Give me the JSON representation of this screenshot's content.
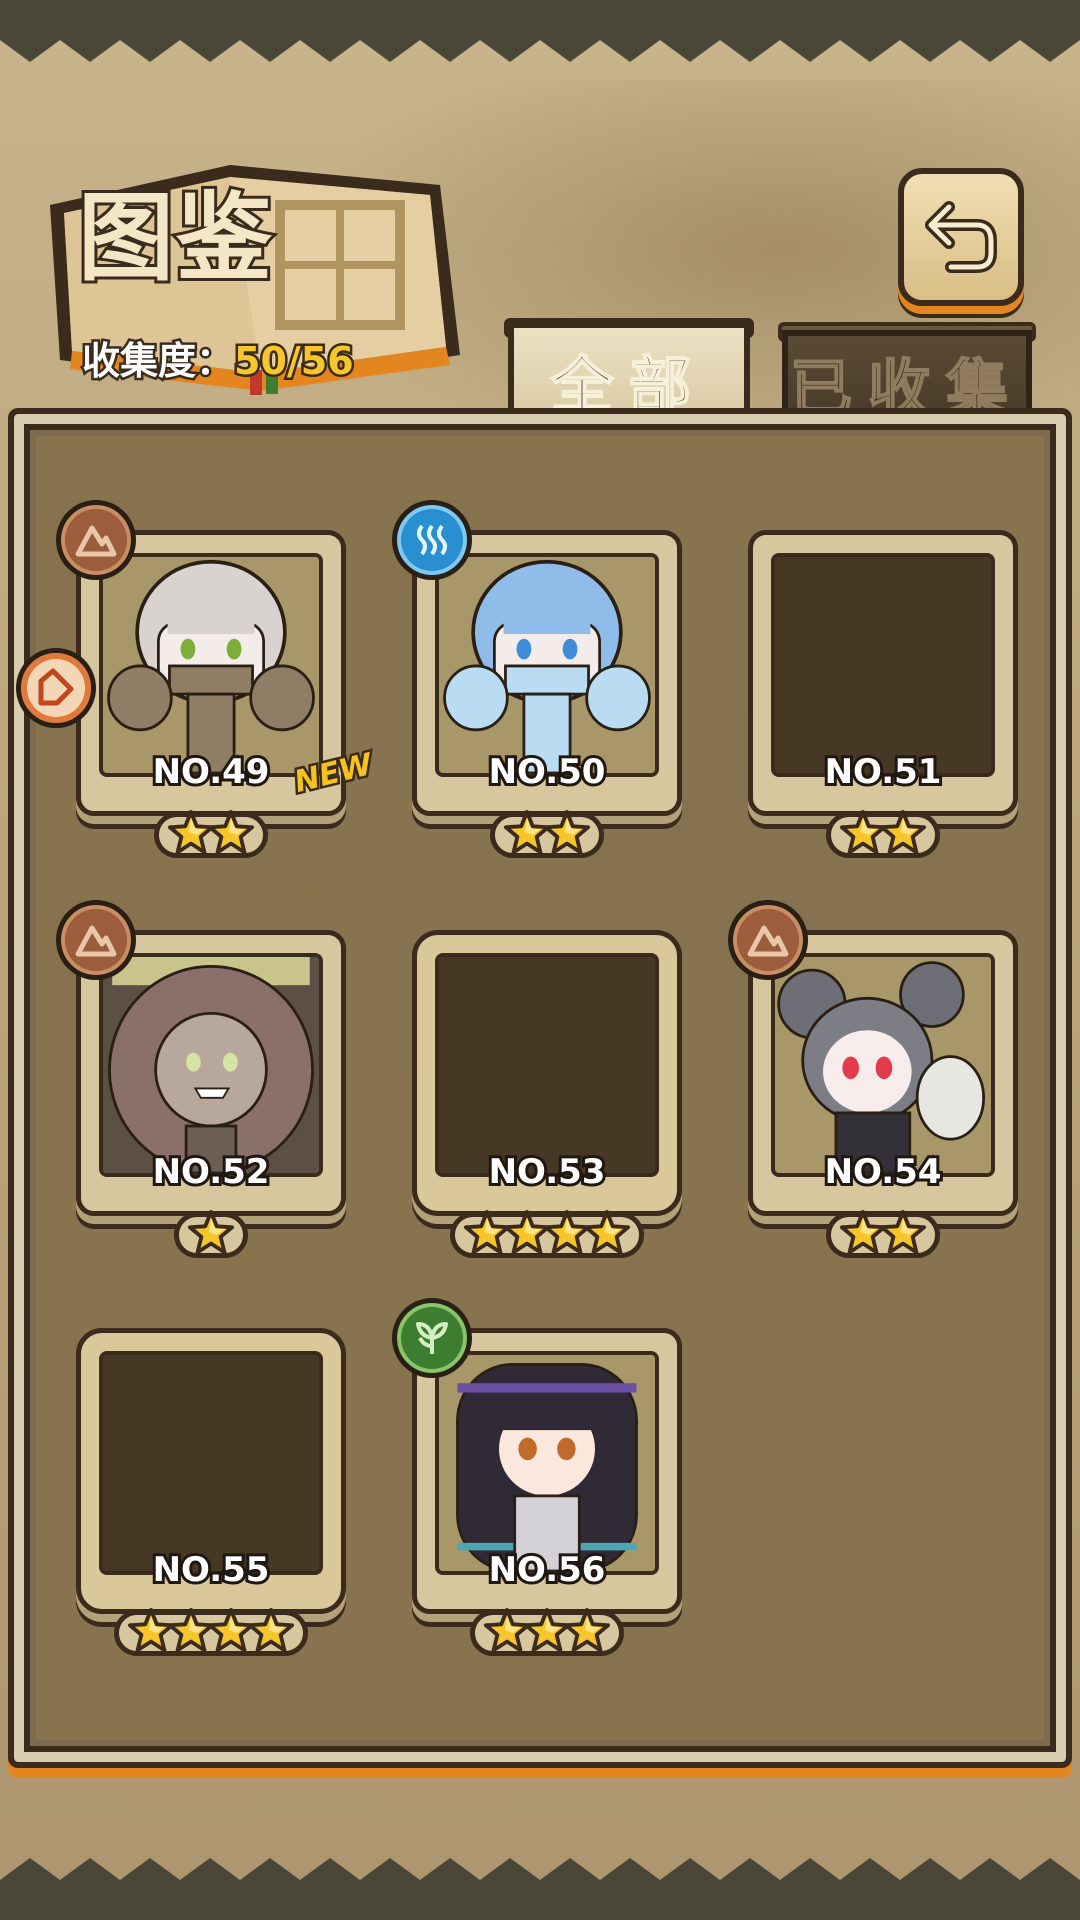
{
  "header": {
    "title": "图鉴",
    "collection_label": "收集度：",
    "collection_value": "50/56",
    "back_icon": "return-arrow-icon"
  },
  "tabs": [
    {
      "label": "全部",
      "selected": true
    },
    {
      "label": "已收集",
      "selected": false
    }
  ],
  "cards": [
    {
      "number": "NO.49",
      "stars": 2,
      "element": "earth",
      "collected": true,
      "new": true,
      "new_label": "NEW",
      "tag_icon": "tag-icon",
      "art": "stone-golem-girl"
    },
    {
      "number": "NO.50",
      "stars": 2,
      "element": "water",
      "collected": true,
      "new": false,
      "art": "ice-golem-girl"
    },
    {
      "number": "NO.51",
      "stars": 2,
      "element": null,
      "collected": false,
      "new": false,
      "art": "silhouette"
    },
    {
      "number": "NO.52",
      "stars": 1,
      "element": "earth",
      "collected": true,
      "new": false,
      "art": "tentacle-girl"
    },
    {
      "number": "NO.53",
      "stars": 4,
      "element": null,
      "collected": false,
      "new": false,
      "art": "silhouette"
    },
    {
      "number": "NO.54",
      "stars": 2,
      "element": "earth",
      "collected": true,
      "new": false,
      "art": "mouse-girl"
    },
    {
      "number": "NO.55",
      "stars": 4,
      "element": null,
      "collected": false,
      "new": false,
      "art": "silhouette"
    },
    {
      "number": "NO.56",
      "stars": 3,
      "element": "grass",
      "collected": true,
      "new": false,
      "art": "long-haired-girl"
    }
  ],
  "colors": {
    "star": "#f7c62a",
    "accent_orange": "#e4861f",
    "earth": "#9b5d3b",
    "water": "#2a8fd0",
    "grass": "#3d7d2f"
  }
}
